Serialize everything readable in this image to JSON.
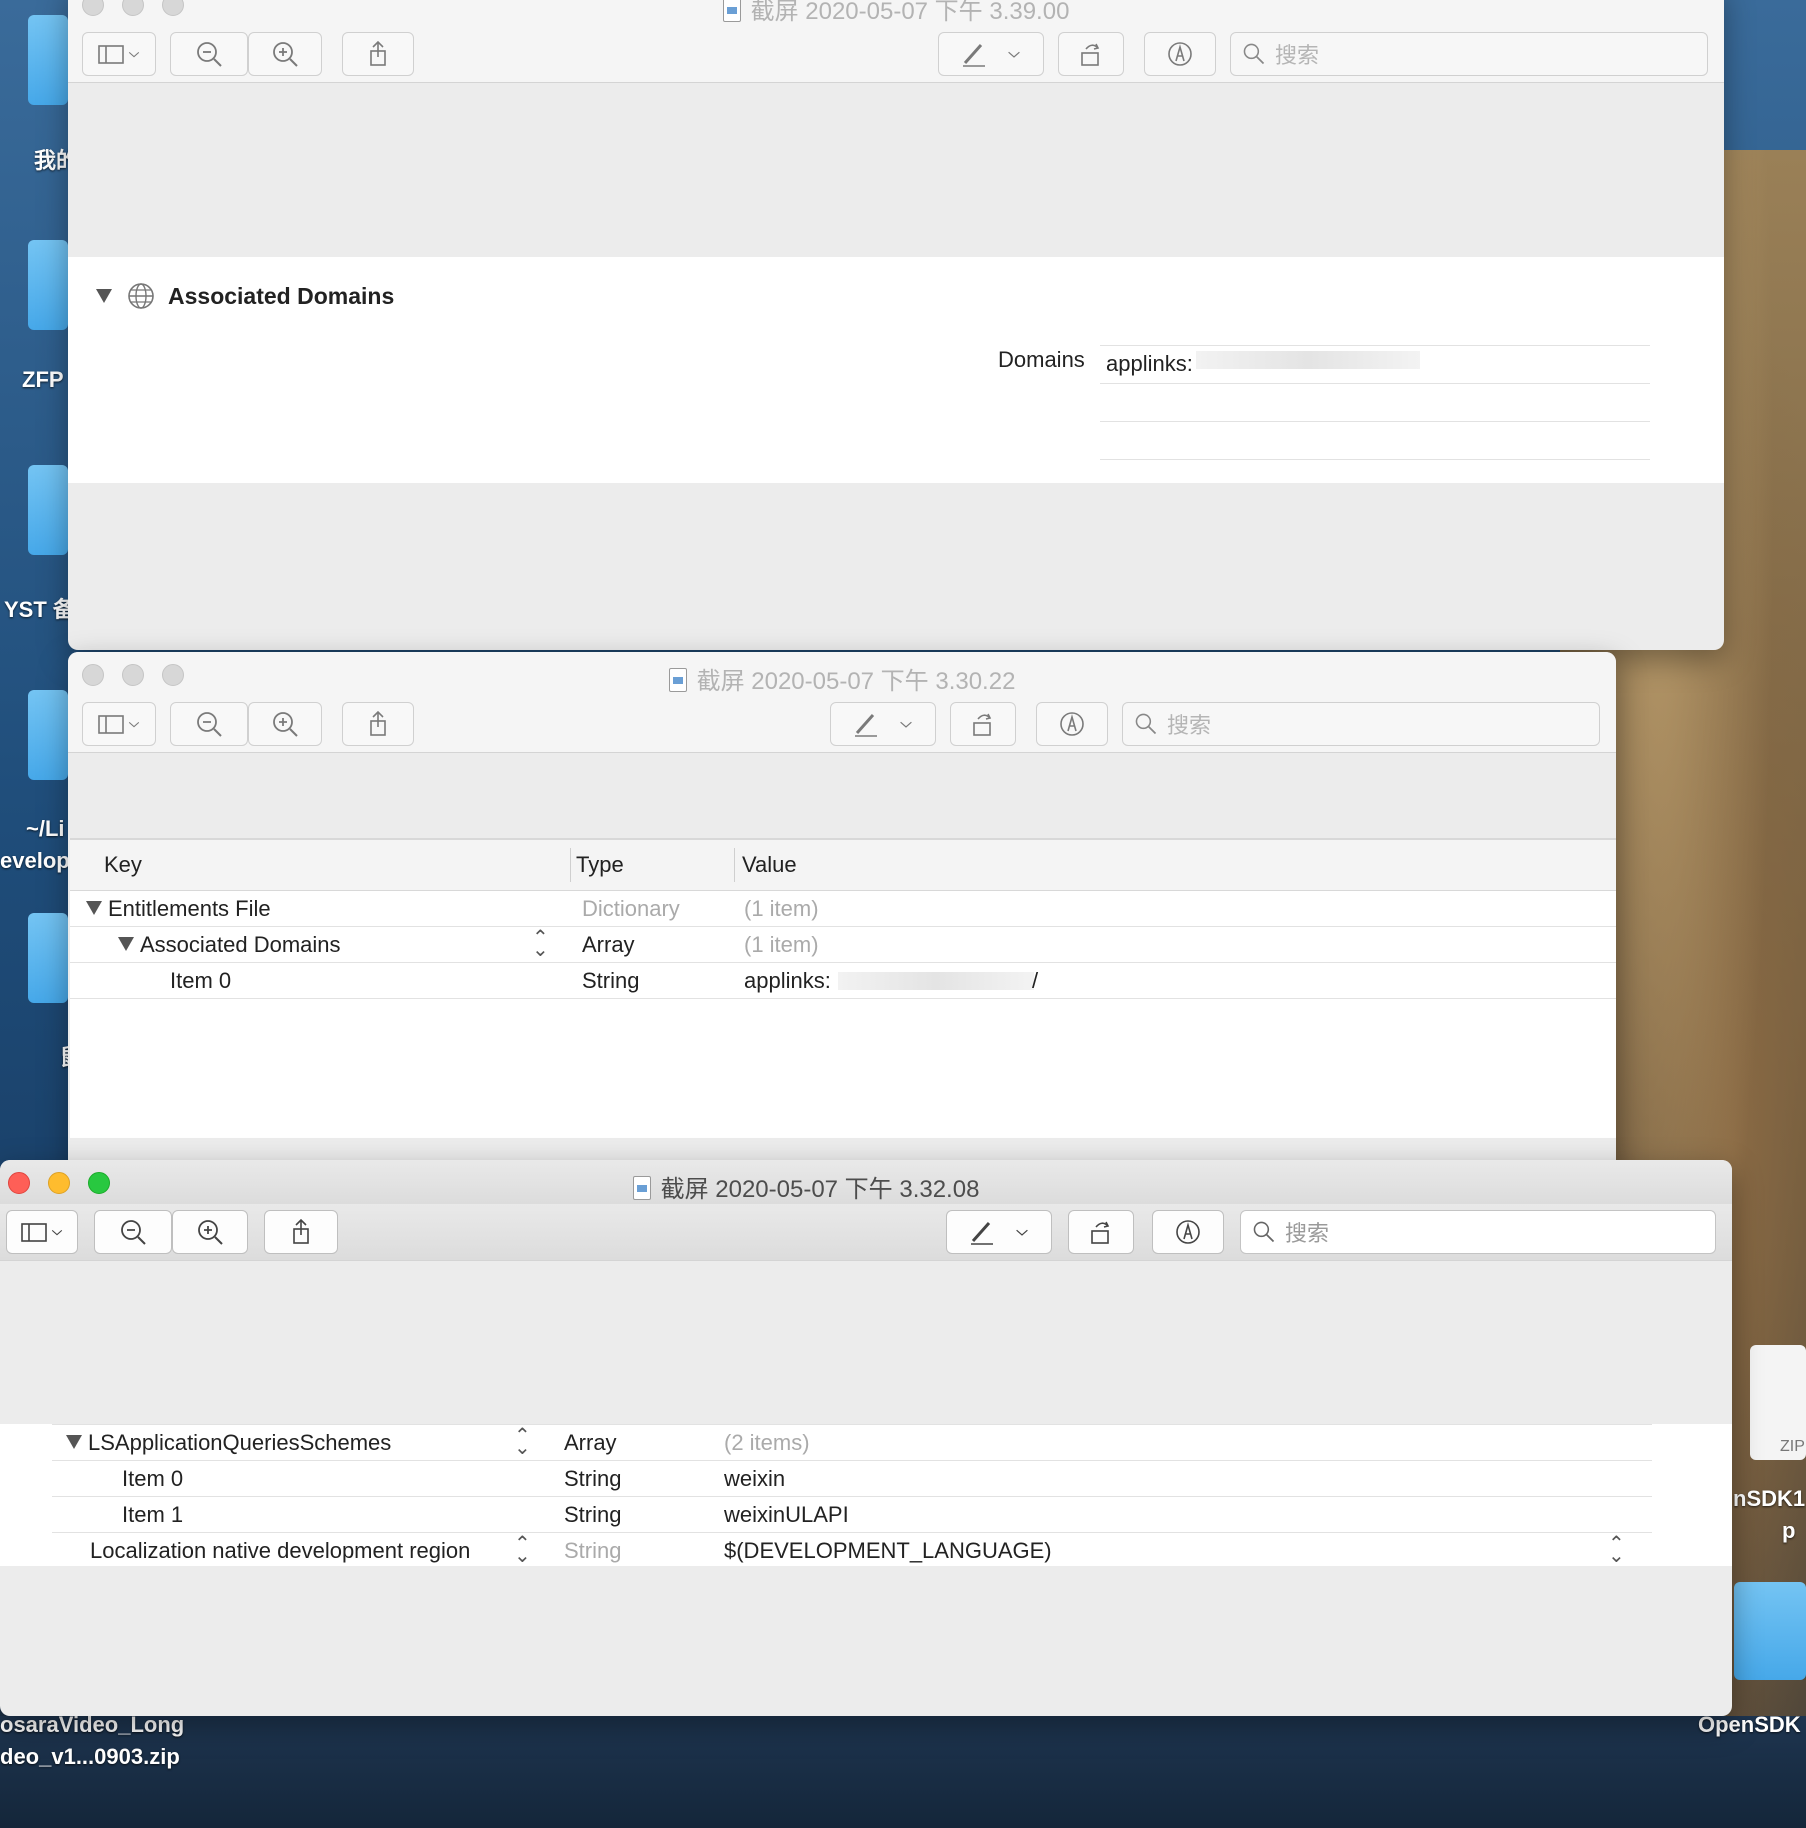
{
  "desktop": {
    "labels": [
      "我的",
      "ZFP",
      "YST 备",
      "~/Li",
      "evelop",
      "鼠",
      "osaraVideo_Long",
      "deo_v1...0903.zip",
      "nSDK1",
      "p",
      "ZIP",
      "OpenSDK"
    ]
  },
  "window1": {
    "title": "截屏 2020-05-07 下午 3.39.00",
    "search_placeholder": "搜索",
    "section_title": "Associated Domains",
    "domains_label": "Domains",
    "domain_value": "applinks:"
  },
  "window2": {
    "title": "截屏 2020-05-07 下午 3.30.22",
    "search_placeholder": "搜索",
    "columns": [
      "Key",
      "Type",
      "Value"
    ],
    "rows": [
      {
        "key": "Entitlements File",
        "type": "Dictionary",
        "value": "(1 item)"
      },
      {
        "key": "Associated Domains",
        "type": "Array",
        "value": "(1 item)"
      },
      {
        "key": "Item 0",
        "type": "String",
        "value": "applinks:",
        "value_suffix": "/"
      }
    ]
  },
  "window3": {
    "title": "截屏 2020-05-07 下午 3.32.08",
    "search_placeholder": "搜索",
    "rows": [
      {
        "key": "LSApplicationQueriesSchemes",
        "type": "Array",
        "value": "(2 items)"
      },
      {
        "key": "Item 0",
        "type": "String",
        "value": "weixin"
      },
      {
        "key": "Item 1",
        "type": "String",
        "value": "weixinULAPI"
      },
      {
        "key": "Localization native development region",
        "type": "String",
        "value": "$(DEVELOPMENT_LANGUAGE)"
      }
    ]
  },
  "icons": {
    "sidebar": "sidebar-toggle-icon",
    "zoom_out": "zoom-out-icon",
    "zoom_in": "zoom-in-icon",
    "share": "share-icon",
    "markup": "markup-pen-icon",
    "rotate": "rotate-icon",
    "annotate": "annotate-icon",
    "search": "search-icon",
    "globe": "globe-icon"
  },
  "colors": {
    "close": "#fe5f57",
    "minimize": "#febc2e",
    "zoom": "#28c840"
  }
}
